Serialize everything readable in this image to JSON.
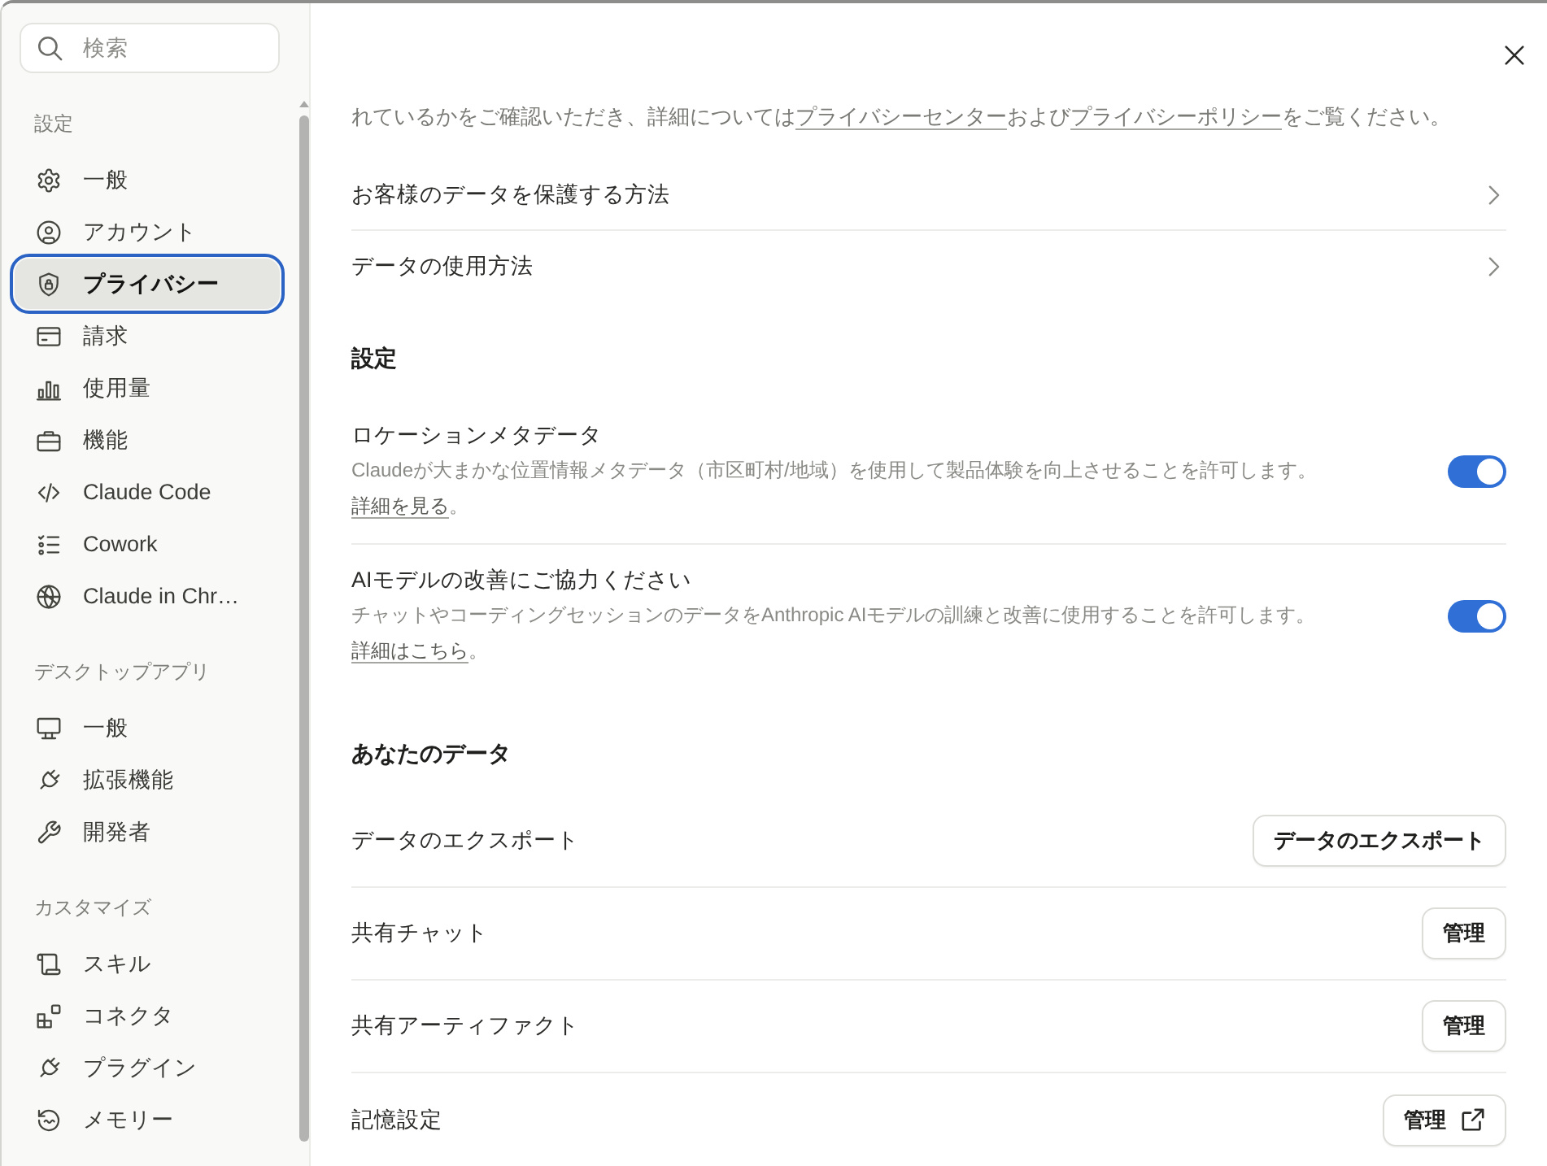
{
  "sidebar": {
    "search": {
      "placeholder": "検索"
    },
    "sections": [
      {
        "label": "設定",
        "items": [
          {
            "label": "一般",
            "selected": false
          },
          {
            "label": "アカウント",
            "selected": false
          },
          {
            "label": "プライバシー",
            "selected": true
          },
          {
            "label": "請求",
            "selected": false
          },
          {
            "label": "使用量",
            "selected": false
          },
          {
            "label": "機能",
            "selected": false
          },
          {
            "label": "Claude Code",
            "selected": false
          },
          {
            "label": "Cowork",
            "selected": false
          },
          {
            "label": "Claude in Chr…",
            "selected": false
          }
        ]
      },
      {
        "label": "デスクトップアプリ",
        "items": [
          {
            "label": "一般",
            "selected": false
          },
          {
            "label": "拡張機能",
            "selected": false
          },
          {
            "label": "開発者",
            "selected": false
          }
        ]
      },
      {
        "label": "カスタマイズ",
        "items": [
          {
            "label": "スキル",
            "selected": false
          },
          {
            "label": "コネクタ",
            "selected": false
          },
          {
            "label": "プラグイン",
            "selected": false
          },
          {
            "label": "メモリー",
            "selected": false
          }
        ]
      }
    ]
  },
  "privacy": {
    "intro": [
      {
        "kind": "text",
        "text": "れているかをご確認いただき、詳細については"
      },
      {
        "kind": "link",
        "text": "プライバシーセンター"
      },
      {
        "kind": "text",
        "text": "および"
      },
      {
        "kind": "link",
        "text": "プライバシーポリシー"
      },
      {
        "kind": "text",
        "text": "をご覧ください。"
      }
    ],
    "links": [
      "お客様のデータを保護する方法",
      "データの使用方法"
    ],
    "settings": {
      "heading": "設定",
      "toggles": [
        {
          "title": "ロケーションメタデータ",
          "description": [
            {
              "kind": "text",
              "text": "Claudeが大まかな位置情報メタデータ（市区町村/地域）を使用して製品体験を向上させることを許可します。"
            },
            {
              "kind": "link",
              "text": "詳細を見る"
            },
            {
              "kind": "text",
              "text": "。"
            }
          ],
          "on": true
        },
        {
          "title": "AIモデルの改善にご協力ください",
          "description": [
            {
              "kind": "text",
              "text": "チャットやコーディングセッションのデータをAnthropic AIモデルの訓練と改善に使用することを許可します。"
            },
            {
              "kind": "link",
              "text": "詳細はこちら"
            },
            {
              "kind": "text",
              "text": "。"
            }
          ],
          "on": true
        }
      ]
    },
    "your_data": {
      "heading": "あなたのデータ",
      "rows": [
        {
          "label": "データのエクスポート",
          "button": "データのエクスポート",
          "kind": "plain"
        },
        {
          "label": "共有チャット",
          "button": "管理",
          "kind": "plain"
        },
        {
          "label": "共有アーティファクト",
          "button": "管理",
          "kind": "plain"
        },
        {
          "label": "記憶設定",
          "button": "管理",
          "kind": "external"
        }
      ]
    }
  }
}
